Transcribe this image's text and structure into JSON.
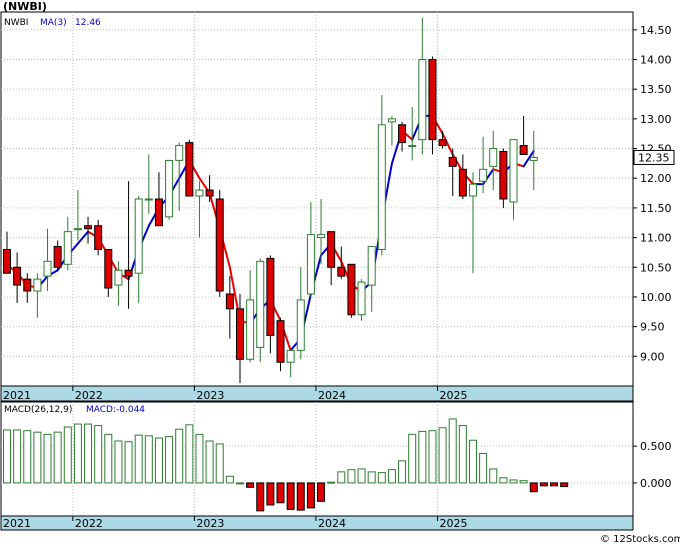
{
  "header": {
    "title": "(NWBI)"
  },
  "colors": {
    "up": "#2e7d32",
    "down": "#dd0000",
    "ma_up": "#0000cc",
    "ma_down": "#ee0000",
    "axis_band": "#add8e6",
    "macd_pos": "#2e7d32",
    "macd_neg": "#dd0000",
    "grid": "#c0c0c0"
  },
  "footer": {
    "copyright": "© 12Stocks.com"
  },
  "chart_data": [
    {
      "type": "candlestick",
      "title": "(NWBI)",
      "legend": {
        "symbol": "NWBI",
        "ma_label": "MA(3)",
        "ma_value": "12.46"
      },
      "last_price_label": "12.35",
      "ylim": [
        8.5,
        14.8
      ],
      "yticks": [
        "9.00",
        "9.50",
        "10.00",
        "10.50",
        "11.00",
        "11.50",
        "12.00",
        "12.50",
        "13.00",
        "13.50",
        "14.00",
        "14.50"
      ],
      "x_labels": [
        {
          "label": "2021",
          "index": 0
        },
        {
          "label": "2022",
          "index": 6.5
        },
        {
          "label": "2023",
          "index": 18.5
        },
        {
          "label": "2024",
          "index": 30.5
        },
        {
          "label": "2025",
          "index": 42.5
        }
      ],
      "candles": [
        {
          "o": 10.8,
          "h": 11.1,
          "l": 10.4,
          "c": 10.4
        },
        {
          "o": 10.5,
          "h": 10.75,
          "l": 9.9,
          "c": 10.2
        },
        {
          "o": 10.3,
          "h": 10.4,
          "l": 9.9,
          "c": 10.1
        },
        {
          "o": 10.1,
          "h": 10.4,
          "l": 9.65,
          "c": 10.3
        },
        {
          "o": 10.35,
          "h": 11.15,
          "l": 10.1,
          "c": 10.6
        },
        {
          "o": 10.85,
          "h": 10.95,
          "l": 10.45,
          "c": 10.5
        },
        {
          "o": 10.55,
          "h": 11.35,
          "l": 10.45,
          "c": 11.1
        },
        {
          "o": 11.15,
          "h": 11.8,
          "l": 10.95,
          "c": 11.15
        },
        {
          "o": 11.2,
          "h": 11.35,
          "l": 10.9,
          "c": 11.15
        },
        {
          "o": 11.2,
          "h": 11.3,
          "l": 10.7,
          "c": 10.8
        },
        {
          "o": 10.8,
          "h": 10.8,
          "l": 10.0,
          "c": 10.15
        },
        {
          "o": 10.2,
          "h": 10.6,
          "l": 9.85,
          "c": 10.45
        },
        {
          "o": 10.45,
          "h": 11.95,
          "l": 9.8,
          "c": 10.35
        },
        {
          "o": 10.4,
          "h": 11.7,
          "l": 9.9,
          "c": 11.65
        },
        {
          "o": 11.65,
          "h": 12.4,
          "l": 11.4,
          "c": 11.65
        },
        {
          "o": 11.65,
          "h": 12.1,
          "l": 11.3,
          "c": 11.2
        },
        {
          "o": 11.35,
          "h": 12.3,
          "l": 11.3,
          "c": 12.3
        },
        {
          "o": 12.3,
          "h": 12.6,
          "l": 11.45,
          "c": 12.55
        },
        {
          "o": 12.6,
          "h": 12.65,
          "l": 11.8,
          "c": 11.7
        },
        {
          "o": 11.7,
          "h": 11.95,
          "l": 11.0,
          "c": 11.8
        },
        {
          "o": 11.8,
          "h": 12.05,
          "l": 11.6,
          "c": 11.7
        },
        {
          "o": 11.65,
          "h": 11.8,
          "l": 10.0,
          "c": 10.1
        },
        {
          "o": 10.05,
          "h": 10.35,
          "l": 9.3,
          "c": 9.8
        },
        {
          "o": 9.8,
          "h": 10.05,
          "l": 8.55,
          "c": 8.95
        },
        {
          "o": 8.95,
          "h": 10.45,
          "l": 8.9,
          "c": 9.95
        },
        {
          "o": 9.15,
          "h": 10.65,
          "l": 8.9,
          "c": 10.6
        },
        {
          "o": 10.65,
          "h": 10.7,
          "l": 9.05,
          "c": 9.35
        },
        {
          "o": 9.6,
          "h": 9.65,
          "l": 8.75,
          "c": 8.9
        },
        {
          "o": 8.9,
          "h": 9.1,
          "l": 8.65,
          "c": 9.1
        },
        {
          "o": 9.1,
          "h": 10.5,
          "l": 8.95,
          "c": 9.95
        },
        {
          "o": 10.05,
          "h": 11.6,
          "l": 10.0,
          "c": 11.05
        },
        {
          "o": 11.0,
          "h": 11.65,
          "l": 10.55,
          "c": 11.05
        },
        {
          "o": 11.1,
          "h": 11.1,
          "l": 10.2,
          "c": 10.5
        },
        {
          "o": 10.5,
          "h": 10.85,
          "l": 10.3,
          "c": 10.35
        },
        {
          "o": 10.55,
          "h": 10.55,
          "l": 9.65,
          "c": 9.7
        },
        {
          "o": 9.7,
          "h": 10.3,
          "l": 9.6,
          "c": 10.25
        },
        {
          "o": 10.2,
          "h": 10.85,
          "l": 9.75,
          "c": 10.85
        },
        {
          "o": 10.8,
          "h": 13.4,
          "l": 10.7,
          "c": 12.9
        },
        {
          "o": 12.95,
          "h": 13.05,
          "l": 12.55,
          "c": 13.0
        },
        {
          "o": 12.9,
          "h": 12.95,
          "l": 12.45,
          "c": 12.6
        },
        {
          "o": 12.55,
          "h": 13.2,
          "l": 12.3,
          "c": 12.55
        },
        {
          "o": 12.65,
          "h": 14.7,
          "l": 12.4,
          "c": 14.0
        },
        {
          "o": 14.0,
          "h": 14.05,
          "l": 12.4,
          "c": 12.65
        },
        {
          "o": 12.65,
          "h": 12.8,
          "l": 12.5,
          "c": 12.55
        },
        {
          "o": 12.35,
          "h": 12.5,
          "l": 11.7,
          "c": 12.2
        },
        {
          "o": 12.15,
          "h": 12.4,
          "l": 11.65,
          "c": 11.7
        },
        {
          "o": 11.7,
          "h": 12.1,
          "l": 10.4,
          "c": 11.9
        },
        {
          "o": 11.95,
          "h": 12.7,
          "l": 11.75,
          "c": 12.15
        },
        {
          "o": 12.2,
          "h": 12.8,
          "l": 11.8,
          "c": 12.5
        },
        {
          "o": 12.45,
          "h": 12.5,
          "l": 11.5,
          "c": 11.65
        },
        {
          "o": 11.6,
          "h": 12.65,
          "l": 11.3,
          "c": 12.65
        },
        {
          "o": 12.55,
          "h": 13.05,
          "l": 12.4,
          "c": 12.4
        },
        {
          "o": 12.3,
          "h": 12.8,
          "l": 11.8,
          "c": 12.35
        }
      ],
      "ma3": [
        10.55,
        10.4,
        10.2,
        10.15,
        10.35,
        10.45,
        10.7,
        10.9,
        11.1,
        11.0,
        10.7,
        10.4,
        10.3,
        10.8,
        11.2,
        11.5,
        11.7,
        12.0,
        12.3,
        12.0,
        11.75,
        11.15,
        10.5,
        9.6,
        9.55,
        9.8,
        9.95,
        9.6,
        9.1,
        9.3,
        10.05,
        10.7,
        10.9,
        10.6,
        10.2,
        10.1,
        10.25,
        11.3,
        12.25,
        12.8,
        12.65,
        13.05,
        13.05,
        12.75,
        12.4,
        12.1,
        11.9,
        11.9,
        12.15,
        12.1,
        12.25,
        12.2,
        12.46
      ],
      "macd": {
        "label": "MACD(26,12,9)",
        "value_label": "MACD:-0.044",
        "ylim": [
          -0.45,
          1.1
        ],
        "yticks": [
          "0.000",
          "0.500"
        ],
        "values": [
          0.72,
          0.72,
          0.71,
          0.69,
          0.66,
          0.69,
          0.76,
          0.8,
          0.8,
          0.78,
          0.66,
          0.57,
          0.56,
          0.65,
          0.64,
          0.61,
          0.63,
          0.73,
          0.79,
          0.66,
          0.57,
          0.53,
          0.09,
          0.0,
          -0.06,
          -0.38,
          -0.3,
          -0.27,
          -0.36,
          -0.37,
          -0.34,
          -0.25,
          0.01,
          0.15,
          0.18,
          0.19,
          0.15,
          0.14,
          0.18,
          0.3,
          0.66,
          0.7,
          0.71,
          0.75,
          0.87,
          0.78,
          0.58,
          0.4,
          0.19,
          0.07,
          0.04,
          0.03,
          -0.12,
          -0.04,
          -0.04,
          -0.05
        ]
      }
    }
  ]
}
